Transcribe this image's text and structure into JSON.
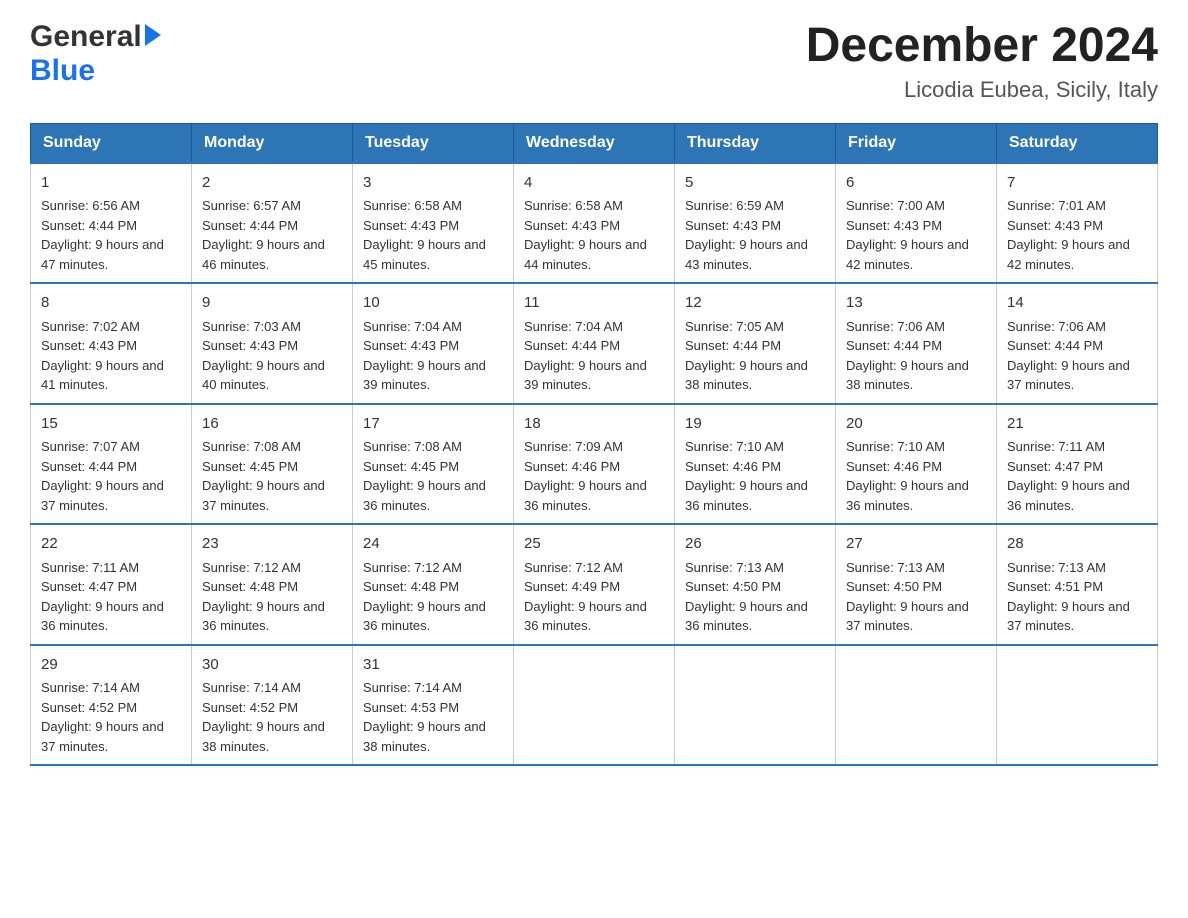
{
  "header": {
    "logo_text1": "General",
    "logo_text2": "Blue",
    "month_title": "December 2024",
    "location": "Licodia Eubea, Sicily, Italy"
  },
  "days_of_week": [
    "Sunday",
    "Monday",
    "Tuesday",
    "Wednesday",
    "Thursday",
    "Friday",
    "Saturday"
  ],
  "weeks": [
    [
      {
        "day": "1",
        "sunrise": "Sunrise: 6:56 AM",
        "sunset": "Sunset: 4:44 PM",
        "daylight": "Daylight: 9 hours and 47 minutes."
      },
      {
        "day": "2",
        "sunrise": "Sunrise: 6:57 AM",
        "sunset": "Sunset: 4:44 PM",
        "daylight": "Daylight: 9 hours and 46 minutes."
      },
      {
        "day": "3",
        "sunrise": "Sunrise: 6:58 AM",
        "sunset": "Sunset: 4:43 PM",
        "daylight": "Daylight: 9 hours and 45 minutes."
      },
      {
        "day": "4",
        "sunrise": "Sunrise: 6:58 AM",
        "sunset": "Sunset: 4:43 PM",
        "daylight": "Daylight: 9 hours and 44 minutes."
      },
      {
        "day": "5",
        "sunrise": "Sunrise: 6:59 AM",
        "sunset": "Sunset: 4:43 PM",
        "daylight": "Daylight: 9 hours and 43 minutes."
      },
      {
        "day": "6",
        "sunrise": "Sunrise: 7:00 AM",
        "sunset": "Sunset: 4:43 PM",
        "daylight": "Daylight: 9 hours and 42 minutes."
      },
      {
        "day": "7",
        "sunrise": "Sunrise: 7:01 AM",
        "sunset": "Sunset: 4:43 PM",
        "daylight": "Daylight: 9 hours and 42 minutes."
      }
    ],
    [
      {
        "day": "8",
        "sunrise": "Sunrise: 7:02 AM",
        "sunset": "Sunset: 4:43 PM",
        "daylight": "Daylight: 9 hours and 41 minutes."
      },
      {
        "day": "9",
        "sunrise": "Sunrise: 7:03 AM",
        "sunset": "Sunset: 4:43 PM",
        "daylight": "Daylight: 9 hours and 40 minutes."
      },
      {
        "day": "10",
        "sunrise": "Sunrise: 7:04 AM",
        "sunset": "Sunset: 4:43 PM",
        "daylight": "Daylight: 9 hours and 39 minutes."
      },
      {
        "day": "11",
        "sunrise": "Sunrise: 7:04 AM",
        "sunset": "Sunset: 4:44 PM",
        "daylight": "Daylight: 9 hours and 39 minutes."
      },
      {
        "day": "12",
        "sunrise": "Sunrise: 7:05 AM",
        "sunset": "Sunset: 4:44 PM",
        "daylight": "Daylight: 9 hours and 38 minutes."
      },
      {
        "day": "13",
        "sunrise": "Sunrise: 7:06 AM",
        "sunset": "Sunset: 4:44 PM",
        "daylight": "Daylight: 9 hours and 38 minutes."
      },
      {
        "day": "14",
        "sunrise": "Sunrise: 7:06 AM",
        "sunset": "Sunset: 4:44 PM",
        "daylight": "Daylight: 9 hours and 37 minutes."
      }
    ],
    [
      {
        "day": "15",
        "sunrise": "Sunrise: 7:07 AM",
        "sunset": "Sunset: 4:44 PM",
        "daylight": "Daylight: 9 hours and 37 minutes."
      },
      {
        "day": "16",
        "sunrise": "Sunrise: 7:08 AM",
        "sunset": "Sunset: 4:45 PM",
        "daylight": "Daylight: 9 hours and 37 minutes."
      },
      {
        "day": "17",
        "sunrise": "Sunrise: 7:08 AM",
        "sunset": "Sunset: 4:45 PM",
        "daylight": "Daylight: 9 hours and 36 minutes."
      },
      {
        "day": "18",
        "sunrise": "Sunrise: 7:09 AM",
        "sunset": "Sunset: 4:46 PM",
        "daylight": "Daylight: 9 hours and 36 minutes."
      },
      {
        "day": "19",
        "sunrise": "Sunrise: 7:10 AM",
        "sunset": "Sunset: 4:46 PM",
        "daylight": "Daylight: 9 hours and 36 minutes."
      },
      {
        "day": "20",
        "sunrise": "Sunrise: 7:10 AM",
        "sunset": "Sunset: 4:46 PM",
        "daylight": "Daylight: 9 hours and 36 minutes."
      },
      {
        "day": "21",
        "sunrise": "Sunrise: 7:11 AM",
        "sunset": "Sunset: 4:47 PM",
        "daylight": "Daylight: 9 hours and 36 minutes."
      }
    ],
    [
      {
        "day": "22",
        "sunrise": "Sunrise: 7:11 AM",
        "sunset": "Sunset: 4:47 PM",
        "daylight": "Daylight: 9 hours and 36 minutes."
      },
      {
        "day": "23",
        "sunrise": "Sunrise: 7:12 AM",
        "sunset": "Sunset: 4:48 PM",
        "daylight": "Daylight: 9 hours and 36 minutes."
      },
      {
        "day": "24",
        "sunrise": "Sunrise: 7:12 AM",
        "sunset": "Sunset: 4:48 PM",
        "daylight": "Daylight: 9 hours and 36 minutes."
      },
      {
        "day": "25",
        "sunrise": "Sunrise: 7:12 AM",
        "sunset": "Sunset: 4:49 PM",
        "daylight": "Daylight: 9 hours and 36 minutes."
      },
      {
        "day": "26",
        "sunrise": "Sunrise: 7:13 AM",
        "sunset": "Sunset: 4:50 PM",
        "daylight": "Daylight: 9 hours and 36 minutes."
      },
      {
        "day": "27",
        "sunrise": "Sunrise: 7:13 AM",
        "sunset": "Sunset: 4:50 PM",
        "daylight": "Daylight: 9 hours and 37 minutes."
      },
      {
        "day": "28",
        "sunrise": "Sunrise: 7:13 AM",
        "sunset": "Sunset: 4:51 PM",
        "daylight": "Daylight: 9 hours and 37 minutes."
      }
    ],
    [
      {
        "day": "29",
        "sunrise": "Sunrise: 7:14 AM",
        "sunset": "Sunset: 4:52 PM",
        "daylight": "Daylight: 9 hours and 37 minutes."
      },
      {
        "day": "30",
        "sunrise": "Sunrise: 7:14 AM",
        "sunset": "Sunset: 4:52 PM",
        "daylight": "Daylight: 9 hours and 38 minutes."
      },
      {
        "day": "31",
        "sunrise": "Sunrise: 7:14 AM",
        "sunset": "Sunset: 4:53 PM",
        "daylight": "Daylight: 9 hours and 38 minutes."
      },
      null,
      null,
      null,
      null
    ]
  ]
}
